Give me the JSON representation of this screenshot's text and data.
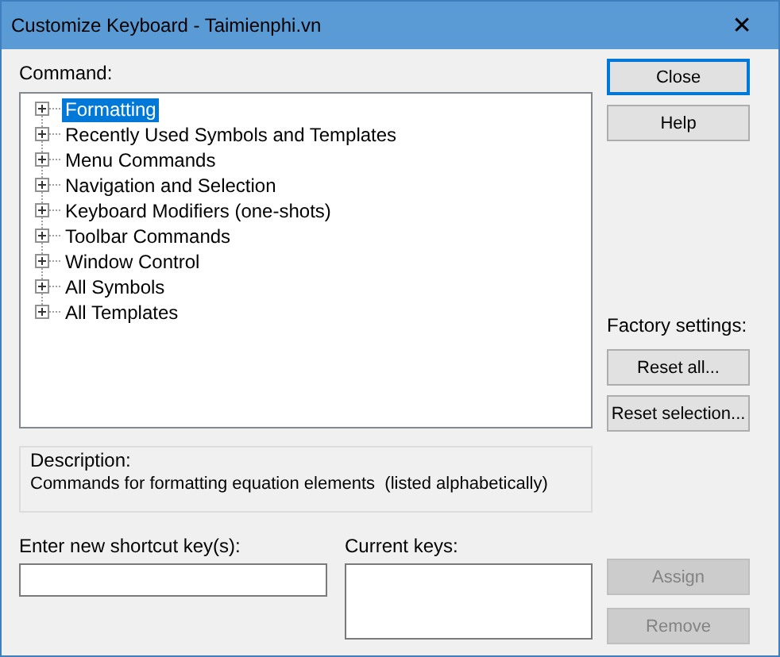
{
  "window": {
    "title": "Customize Keyboard - Taimienphi.vn",
    "close_glyph": "✕"
  },
  "command": {
    "label": "Command:",
    "items": [
      {
        "label": "Formatting",
        "selected": true,
        "expanded": false
      },
      {
        "label": "Recently Used Symbols and Templates",
        "selected": false,
        "expanded": false
      },
      {
        "label": "Menu Commands",
        "selected": false,
        "expanded": false
      },
      {
        "label": "Navigation and Selection",
        "selected": false,
        "expanded": false
      },
      {
        "label": "Keyboard Modifiers (one-shots)",
        "selected": false,
        "expanded": false
      },
      {
        "label": "Toolbar Commands",
        "selected": false,
        "expanded": false
      },
      {
        "label": "Window Control",
        "selected": false,
        "expanded": false
      },
      {
        "label": "All Symbols",
        "selected": false,
        "expanded": false
      },
      {
        "label": "All Templates",
        "selected": false,
        "expanded": false
      }
    ]
  },
  "description": {
    "label": "Description:",
    "text": "Commands for formatting equation elements  (listed alphabetically)"
  },
  "shortcut": {
    "label": "Enter new shortcut key(s):"
  },
  "current_keys": {
    "label": "Current keys:"
  },
  "buttons_top": [
    {
      "label": "Close",
      "default": true,
      "disabled": false
    },
    {
      "label": "Help",
      "default": false,
      "disabled": false
    }
  ],
  "factory": {
    "label": "Factory settings:",
    "buttons": [
      {
        "label": "Reset all...",
        "default": false,
        "disabled": false
      },
      {
        "label": "Reset selection...",
        "default": false,
        "disabled": false
      }
    ]
  },
  "buttons_bottom": [
    {
      "label": "Assign",
      "default": false,
      "disabled": true
    },
    {
      "label": "Remove",
      "default": false,
      "disabled": true
    }
  ]
}
